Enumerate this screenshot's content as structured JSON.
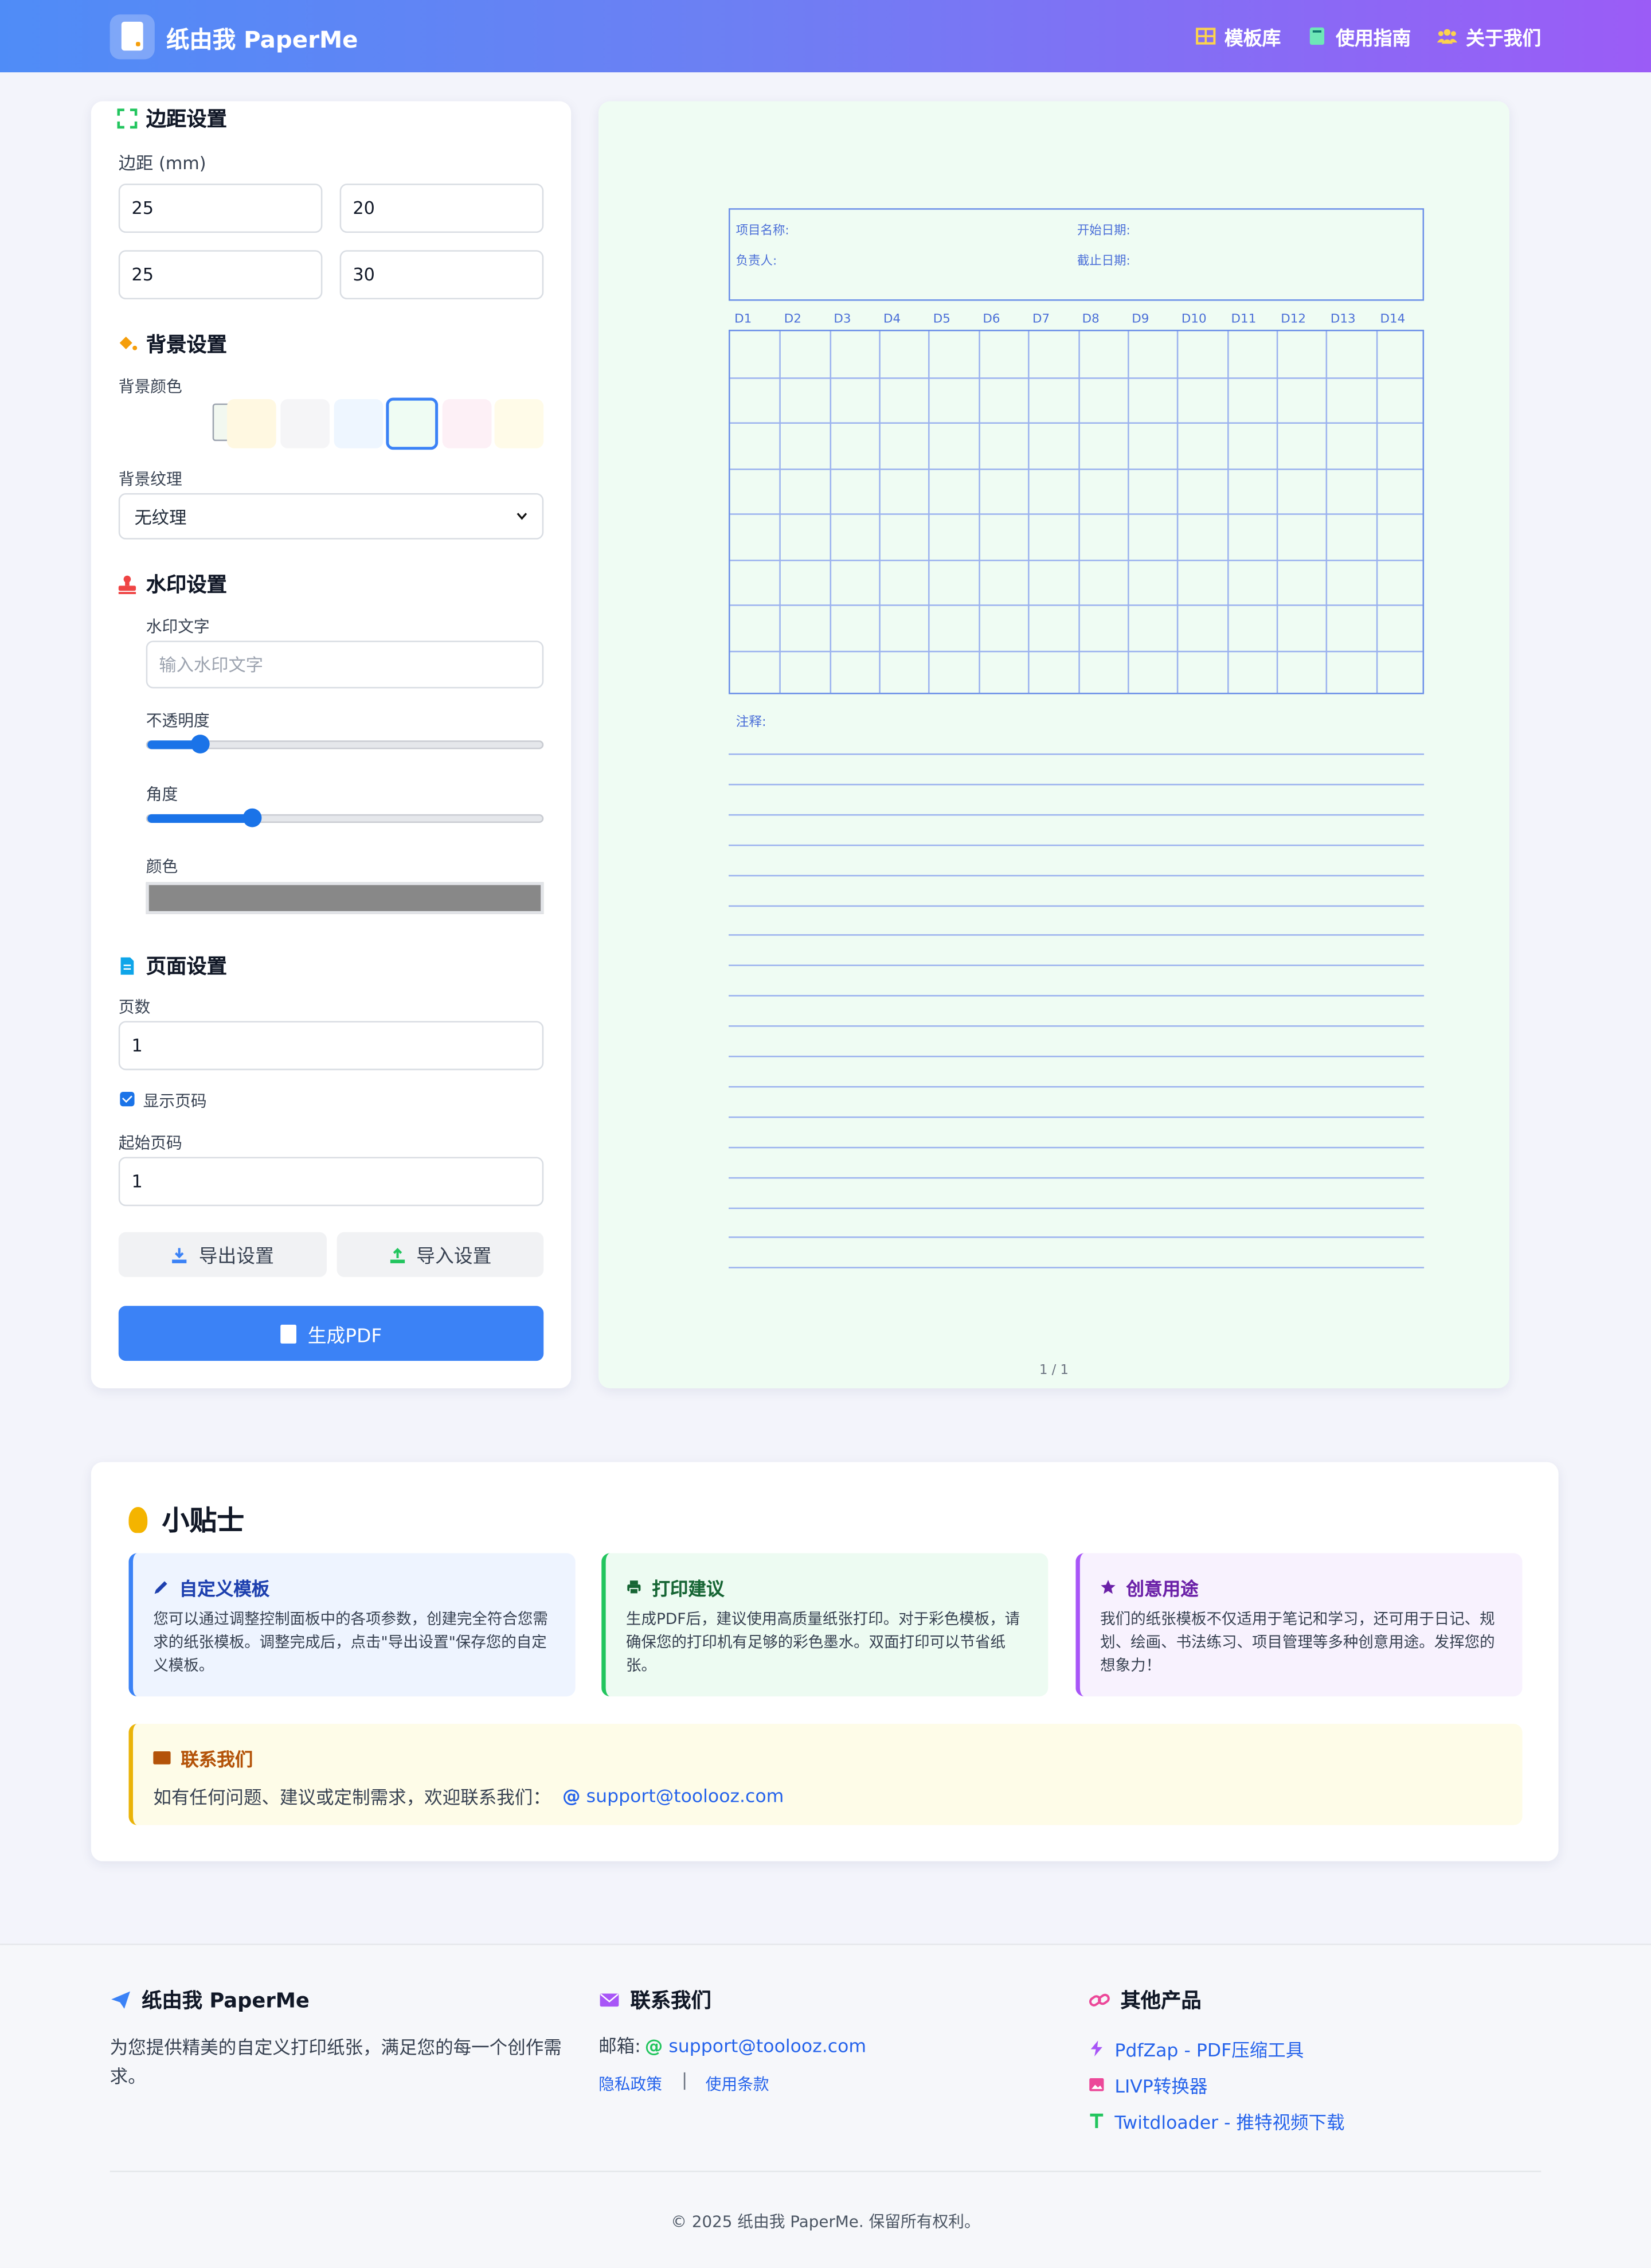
{
  "header": {
    "brand": "纸由我 PaperMe",
    "nav": [
      {
        "label": "模板库",
        "icon": "grid-icon"
      },
      {
        "label": "使用指南",
        "icon": "book-icon"
      },
      {
        "label": "关于我们",
        "icon": "users-icon"
      }
    ]
  },
  "control": {
    "margin": {
      "title": "边距设置",
      "label": "边距 (mm)",
      "values": [
        "25",
        "20",
        "25",
        "30"
      ]
    },
    "background": {
      "title": "背景设置",
      "color_label": "背景颜色",
      "colors": [
        "#f2f8f0",
        "#fff8e1",
        "#f5f5f7",
        "#eef6ff",
        "#effcf3",
        "#fdf0f6",
        "#fffbe8"
      ],
      "selected_index": 4,
      "texture_label": "背景纹理",
      "texture_value": "无纹理"
    },
    "watermark": {
      "title": "水印设置",
      "text_label": "水印文字",
      "text_placeholder": "输入水印文字",
      "opacity_label": "不透明度",
      "opacity_value": 0.13,
      "angle_label": "角度",
      "angle_value": 0.26,
      "color_label": "颜色",
      "color": "#888888"
    },
    "page": {
      "title": "页面设置",
      "count_label": "页数",
      "count_value": "1",
      "show_number_label": "显示页码",
      "show_number_checked": true,
      "start_label": "起始页码",
      "start_value": "1"
    },
    "buttons": {
      "export": "导出设置",
      "import": "导入设置",
      "generate": "生成PDF"
    }
  },
  "preview": {
    "project_name": "项目名称:",
    "start_date": "开始日期:",
    "owner": "负责人:",
    "end_date": "截止日期:",
    "days": [
      "D1",
      "D2",
      "D3",
      "D4",
      "D5",
      "D6",
      "D7",
      "D8",
      "D9",
      "D10",
      "D11",
      "D12",
      "D13",
      "D14"
    ],
    "rows": 8,
    "notes_label": "注释:",
    "note_lines": 18,
    "page_indicator": "1 / 1",
    "line_color": "#9bb2ef",
    "accent": "#4b6fd8"
  },
  "tips": {
    "title": "小贴士",
    "cards": [
      {
        "title": "自定义模板",
        "text": "您可以通过调整控制面板中的各项参数，创建完全符合您需求的纸张模板。调整完成后，点击\"导出设置\"保存您的自定义模板。",
        "color": "#3b82f6",
        "bg": "#eef4ff",
        "title_color": "#1e40af"
      },
      {
        "title": "打印建议",
        "text": "生成PDF后，建议使用高质量纸张打印。对于彩色模板，请确保您的打印机有足够的彩色墨水。双面打印可以节省纸张。",
        "color": "#22c55e",
        "bg": "#edfbf2",
        "title_color": "#166534"
      },
      {
        "title": "创意用途",
        "text": "我们的纸张模板不仅适用于笔记和学习，还可用于日记、规划、绘画、书法练习、项目管理等多种创意用途。发挥您的想象力！",
        "color": "#a855f7",
        "bg": "#f8f2fe",
        "title_color": "#6b21a8"
      }
    ],
    "contact": {
      "title": "联系我们",
      "text": "如有任何问题、建议或定制需求，欢迎联系我们：",
      "email": "support@toolooz.com"
    }
  },
  "footer": {
    "col1": {
      "title": "纸由我 PaperMe",
      "text": "为您提供精美的自定义打印纸张，满足您的每一个创作需求。"
    },
    "col2": {
      "title": "联系我们",
      "email_label": "邮箱:",
      "email": "support@toolooz.com",
      "privacy": "隐私政策",
      "terms": "使用条款"
    },
    "col3": {
      "title": "其他产品",
      "items": [
        "PdfZap - PDF压缩工具",
        "LIVP转换器",
        "Twitdloader - 推特视频下载"
      ]
    },
    "copyright": "2025 纸由我 PaperMe. 保留所有权利。"
  }
}
